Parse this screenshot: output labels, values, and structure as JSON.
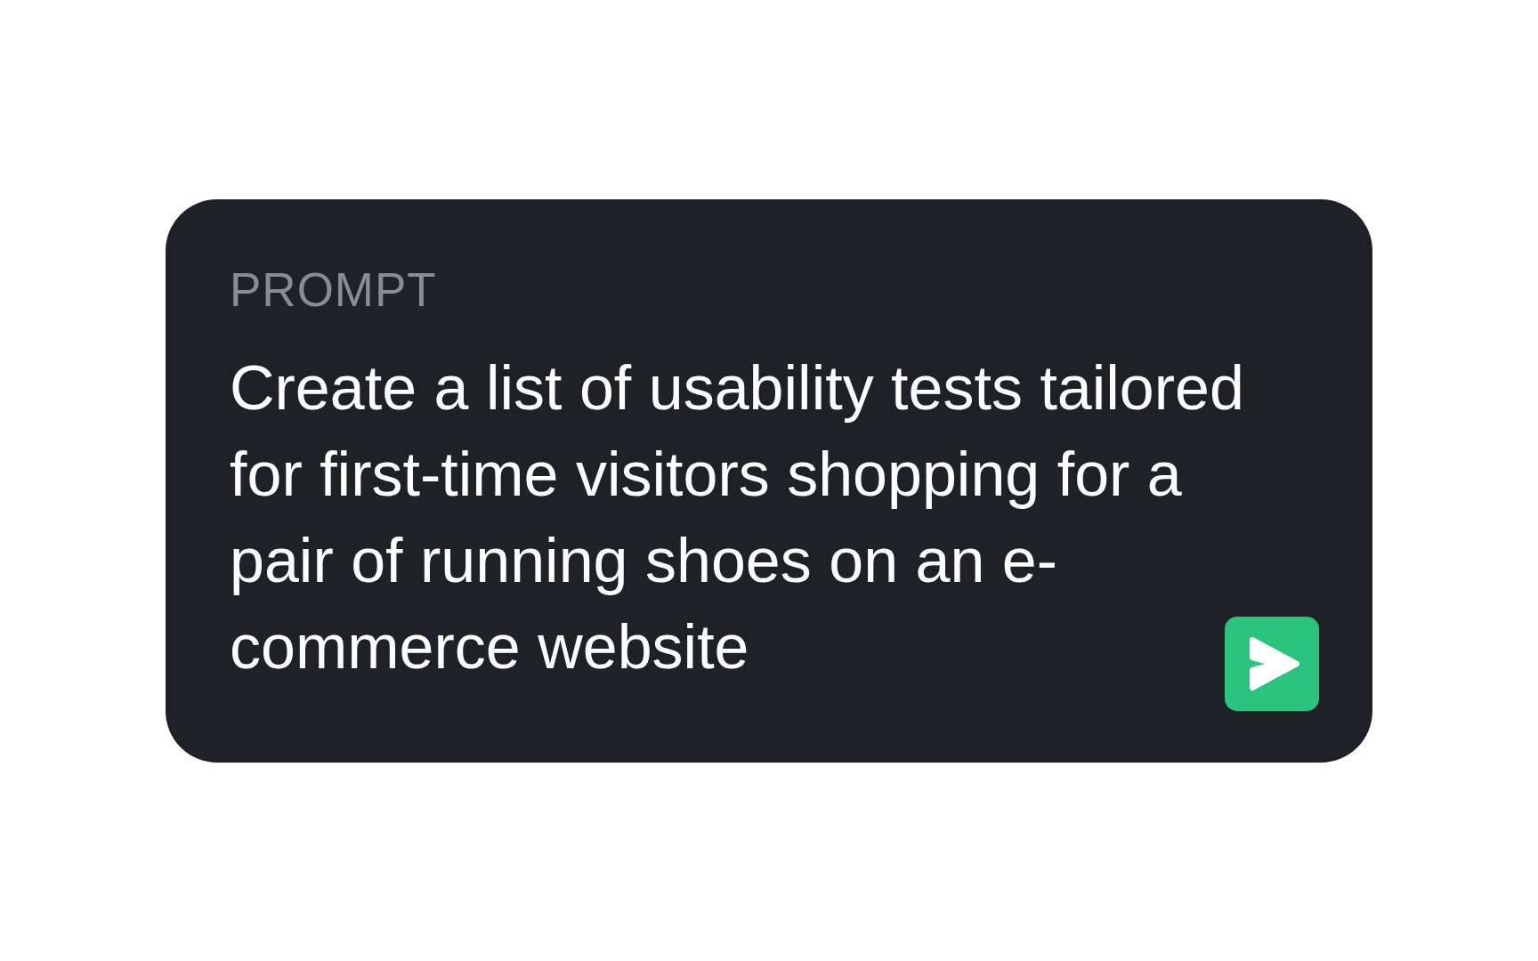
{
  "prompt_card": {
    "label": "PROMPT",
    "text": "Create a list of usability tests tailored for first-time visitors shopping for a pair of running shoes on an e-commerce website"
  }
}
